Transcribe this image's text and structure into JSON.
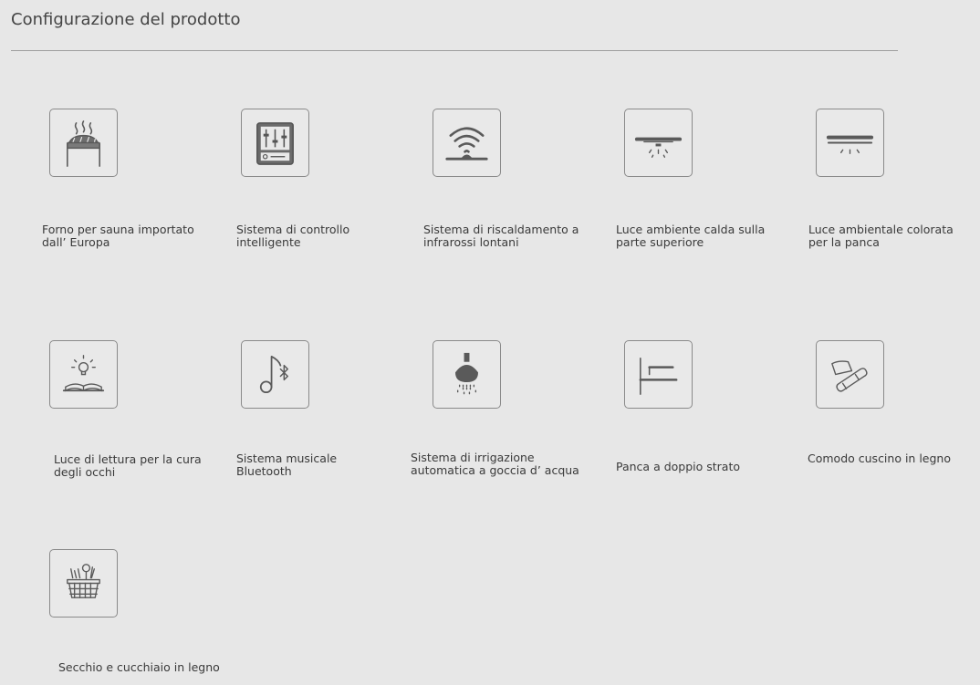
{
  "page": {
    "title": "Configurazione del prodotto"
  },
  "features": [
    {
      "icon": "sauna-stove-icon",
      "label": "Forno per sauna importato\ndall’  Europa"
    },
    {
      "icon": "control-panel-icon",
      "label": "Sistema di controllo\nintelligente"
    },
    {
      "icon": "infrared-heating-icon",
      "label": "Sistema di riscaldamento a\ninfrarossi lontani"
    },
    {
      "icon": "ceiling-light-icon",
      "label": "Luce ambiente calda sulla\nparte superiore"
    },
    {
      "icon": "bench-light-icon",
      "label": "Luce ambientale colorata\n per la panca"
    },
    {
      "icon": "reading-light-icon",
      "label": "Luce di lettura per la cura\ndegli occhi"
    },
    {
      "icon": "bluetooth-music-icon",
      "label": "Sistema musicale\nBluetooth"
    },
    {
      "icon": "water-drip-icon",
      "label": "Sistema di irrigazione\nautomatica a goccia d’  acqua"
    },
    {
      "icon": "double-bench-icon",
      "label": "Panca a doppio strato"
    },
    {
      "icon": "wooden-pillow-icon",
      "label": "Comodo cuscino in legno"
    },
    {
      "icon": "bucket-ladle-icon",
      "label": "Secchio e cucchiaio in legno"
    }
  ],
  "colors": {
    "background": "#e7e7e7",
    "icon_stroke": "#5a5a5a",
    "text": "#3a3a3a"
  }
}
